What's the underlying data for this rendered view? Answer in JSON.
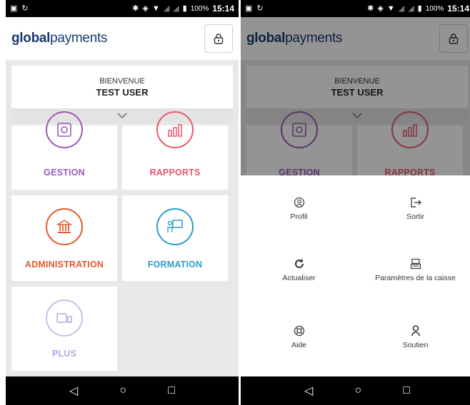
{
  "status_bar": {
    "battery": "100%",
    "time": "15:14"
  },
  "header": {
    "logo_bold": "global",
    "logo_light": "payments",
    "lock_icon": "lock-icon"
  },
  "welcome": {
    "title": "BIENVENUE",
    "user": "TEST USER",
    "expand_icon": "chevron-down-icon"
  },
  "tiles": {
    "gestion": {
      "label": "GESTION",
      "color": "#9b59b6",
      "icon": "safe-icon"
    },
    "rapports": {
      "label": "RAPPORTS",
      "color": "#e8586a",
      "icon": "bar-chart-icon"
    },
    "administration": {
      "label": "ADMINISTRATION",
      "color": "#e05a2b",
      "icon": "bank-icon"
    },
    "formation": {
      "label": "FORMATION",
      "color": "#2a9dc4",
      "icon": "presentation-icon"
    },
    "plus": {
      "label": "PLUS",
      "color": "#b5a8e0",
      "icon": "devices-icon"
    }
  },
  "menu": {
    "profil": {
      "label": "Profil",
      "icon": "user-circle-icon"
    },
    "sortir": {
      "label": "Sortir",
      "icon": "logout-icon"
    },
    "actualiser": {
      "label": "Actualiser",
      "icon": "refresh-icon"
    },
    "parametres": {
      "label": "Paramètres de la caisse",
      "icon": "register-icon"
    },
    "aide": {
      "label": "Aide",
      "icon": "lifebuoy-icon"
    },
    "soutien": {
      "label": "Soutien",
      "icon": "support-icon"
    }
  },
  "nav": {
    "back": "back-icon",
    "home": "home-icon",
    "recents": "recents-icon"
  }
}
